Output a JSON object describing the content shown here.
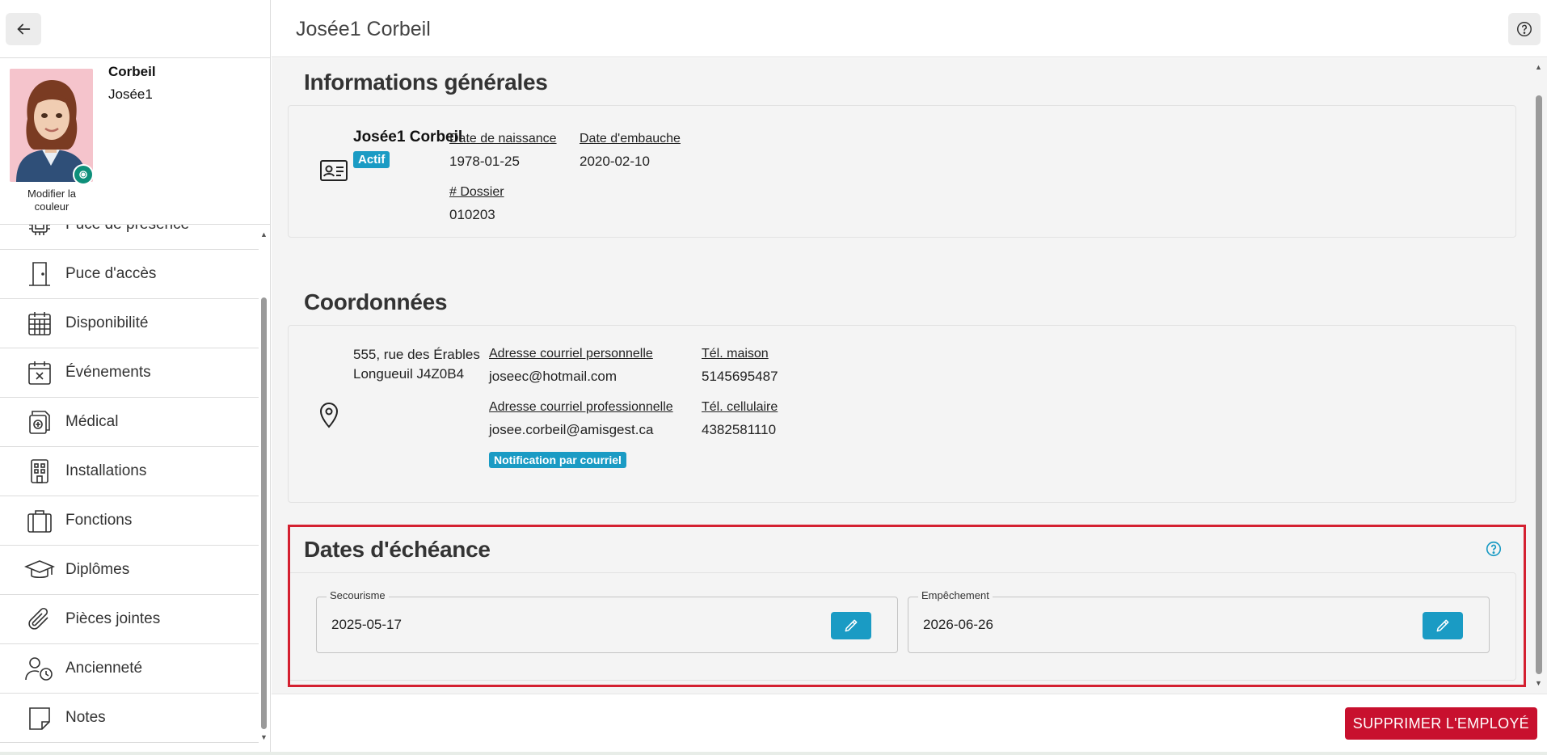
{
  "header": {
    "title": "Josée1 Corbeil"
  },
  "profile": {
    "last_name": "Corbeil",
    "first_name": "Josée1",
    "avatar_caption": "Modifier la couleur"
  },
  "nav": {
    "items": [
      {
        "label": "Puce de présence",
        "icon": "chip-icon"
      },
      {
        "label": "Puce d'accès",
        "icon": "door-icon"
      },
      {
        "label": "Disponibilité",
        "icon": "calendar-grid-icon"
      },
      {
        "label": "Événements",
        "icon": "calendar-x-icon"
      },
      {
        "label": "Médical",
        "icon": "medical-file-icon"
      },
      {
        "label": "Installations",
        "icon": "building-icon"
      },
      {
        "label": "Fonctions",
        "icon": "briefcase-icon"
      },
      {
        "label": "Diplômes",
        "icon": "graduation-cap-icon"
      },
      {
        "label": "Pièces jointes",
        "icon": "paperclip-icon"
      },
      {
        "label": "Ancienneté",
        "icon": "user-clock-icon"
      },
      {
        "label": "Notes",
        "icon": "note-icon"
      }
    ]
  },
  "general": {
    "title": "Informations générales",
    "full_name": "Josée1 Corbeil",
    "status_badge": "Actif",
    "birth_label": "Date de naissance",
    "birth_value": "1978-01-25",
    "hire_label": "Date d'embauche",
    "hire_value": "2020-02-10",
    "file_label": "# Dossier",
    "file_value": "010203"
  },
  "contact": {
    "title": "Coordonnées",
    "address_line1": "555, rue des Érables",
    "address_line2": "Longueuil J4Z0B4",
    "personal_email_label": "Adresse courriel personnelle",
    "personal_email_value": "joseec@hotmail.com",
    "pro_email_label": "Adresse courriel professionnelle",
    "pro_email_value": "josee.corbeil@amisgest.ca",
    "notification_badge": "Notification par courriel",
    "home_phone_label": "Tél. maison",
    "home_phone_value": "5145695487",
    "cell_phone_label": "Tél. cellulaire",
    "cell_phone_value": "4382581110"
  },
  "due_dates": {
    "title": "Dates d'échéance",
    "first_aid_label": "Secourisme",
    "first_aid_value": "2025-05-17",
    "impediment_label": "Empêchement",
    "impediment_value": "2026-06-26"
  },
  "footer": {
    "delete_label": "SUPPRIMER L'EMPLOYÉ"
  },
  "colors": {
    "accent": "#1a9bc4",
    "danger": "#c8102e",
    "highlight": "#d42030"
  }
}
